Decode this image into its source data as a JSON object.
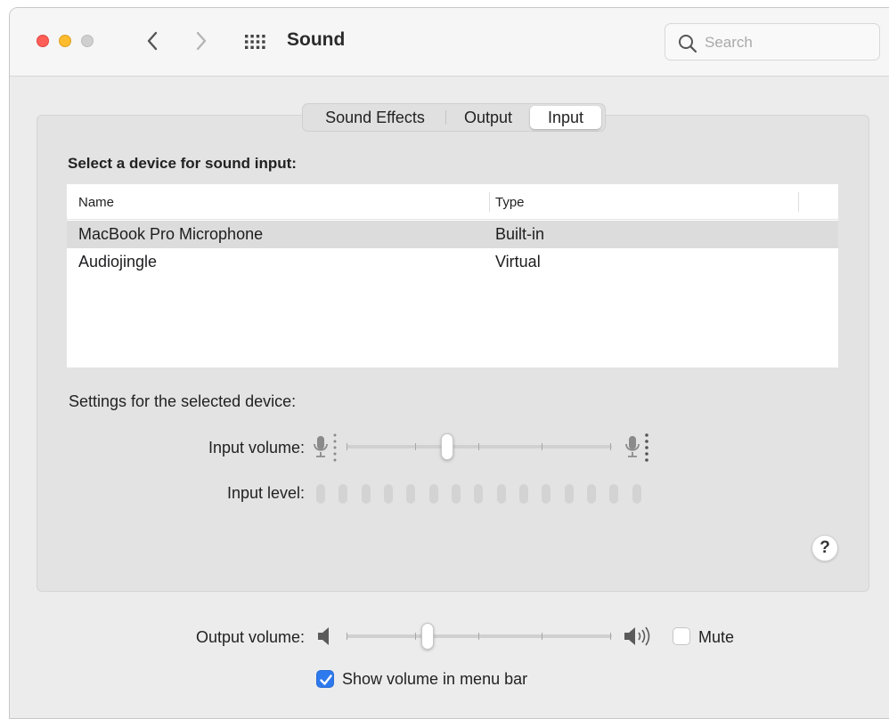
{
  "window": {
    "title": "Sound",
    "search_placeholder": "Search"
  },
  "tabs": [
    {
      "label": "Sound Effects",
      "selected": false
    },
    {
      "label": "Output",
      "selected": false
    },
    {
      "label": "Input",
      "selected": true
    }
  ],
  "input_section": {
    "heading": "Select a device for sound input:",
    "columns": [
      "Name",
      "Type"
    ],
    "devices": [
      {
        "name": "MacBook Pro Microphone",
        "type": "Built-in",
        "selected": true
      },
      {
        "name": "Audiojingle",
        "type": "Virtual",
        "selected": false
      }
    ],
    "settings_label": "Settings for the selected device:",
    "input_volume_label": "Input volume:",
    "input_volume_level": 0.36,
    "input_level_label": "Input level:",
    "input_level_bars_lit": 0
  },
  "help_label": "?",
  "output": {
    "volume_label": "Output volume:",
    "volume_level": 0.32,
    "mute_label": "Mute",
    "mute_checked": false,
    "show_in_menu_bar_label": "Show volume in menu bar",
    "show_in_menu_bar_checked": true
  },
  "colors": {
    "accent": "#2d79ee",
    "close": "#ff5f57",
    "minimize": "#febc2e"
  }
}
